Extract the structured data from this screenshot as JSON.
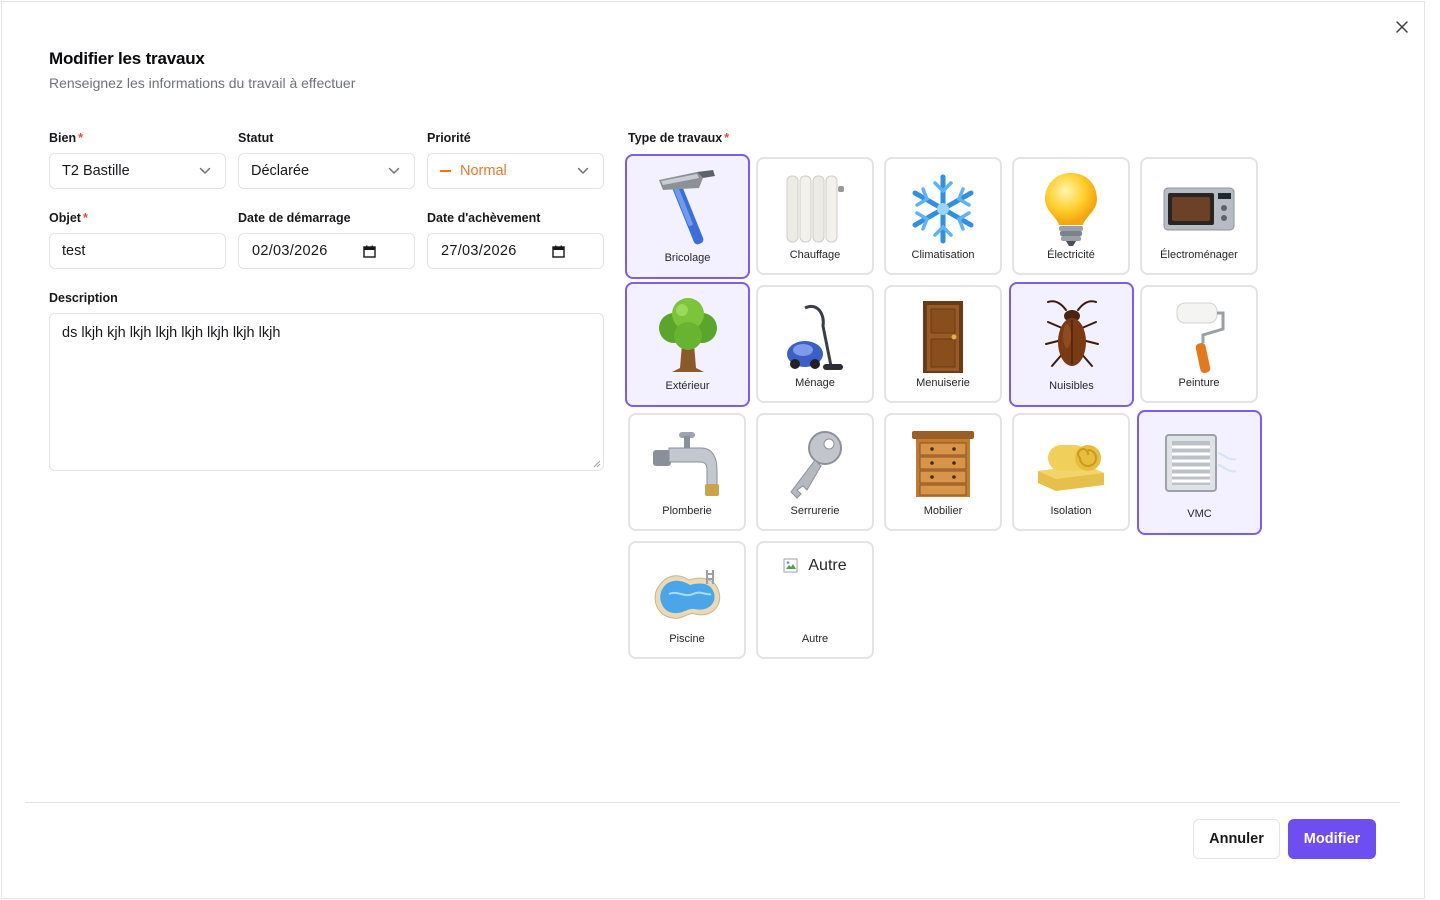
{
  "dialog": {
    "title": "Modifier les travaux",
    "subtitle": "Renseignez les informations du travail à effectuer",
    "close_icon": "close-icon"
  },
  "form": {
    "bien": {
      "label": "Bien",
      "required": "*",
      "value": "T2 Bastille"
    },
    "statut": {
      "label": "Statut",
      "value": "Déclarée"
    },
    "priorite": {
      "label": "Priorité",
      "value": "Normal",
      "color": "#ea7a2a"
    },
    "objet": {
      "label": "Objet",
      "required": "*",
      "value": "test"
    },
    "date_demarrage": {
      "label": "Date de démarrage",
      "value": "02/03/2026"
    },
    "date_achevement": {
      "label": "Date d'achèvement",
      "value": "27/03/2026"
    },
    "description": {
      "label": "Description",
      "value": "ds lkjh kjh lkjh lkjh lkjh lkjh lkjh lkjh"
    }
  },
  "types": {
    "label": "Type de travaux",
    "required": "*",
    "items": [
      {
        "label": "Bricolage",
        "icon": "hammer-icon",
        "selected": true
      },
      {
        "label": "Chauffage",
        "icon": "radiator-icon",
        "selected": false
      },
      {
        "label": "Climatisation",
        "icon": "snowflake-icon",
        "selected": false
      },
      {
        "label": "Électricité",
        "icon": "light-bulb-icon",
        "selected": false
      },
      {
        "label": "Électroménager",
        "icon": "microwave-icon",
        "selected": false
      },
      {
        "label": "Extérieur",
        "icon": "tree-icon",
        "selected": true
      },
      {
        "label": "Ménage",
        "icon": "vacuum-icon",
        "selected": false
      },
      {
        "label": "Menuiserie",
        "icon": "door-icon",
        "selected": false
      },
      {
        "label": "Nuisibles",
        "icon": "cockroach-icon",
        "selected": true
      },
      {
        "label": "Peinture",
        "icon": "paint-roller-icon",
        "selected": false
      },
      {
        "label": "Plomberie",
        "icon": "faucet-icon",
        "selected": false
      },
      {
        "label": "Serrurerie",
        "icon": "key-icon",
        "selected": false
      },
      {
        "label": "Mobilier",
        "icon": "dresser-icon",
        "selected": false
      },
      {
        "label": "Isolation",
        "icon": "insulation-roll-icon",
        "selected": false
      },
      {
        "label": "VMC",
        "icon": "vent-icon",
        "selected": true
      },
      {
        "label": "Piscine",
        "icon": "pool-icon",
        "selected": false
      },
      {
        "label": "Autre",
        "icon": "broken-image-icon",
        "selected": false,
        "alt_text": "Autre"
      }
    ]
  },
  "footer": {
    "cancel_label": "Annuler",
    "submit_label": "Modifier",
    "accent_color": "#6d4ef0"
  }
}
